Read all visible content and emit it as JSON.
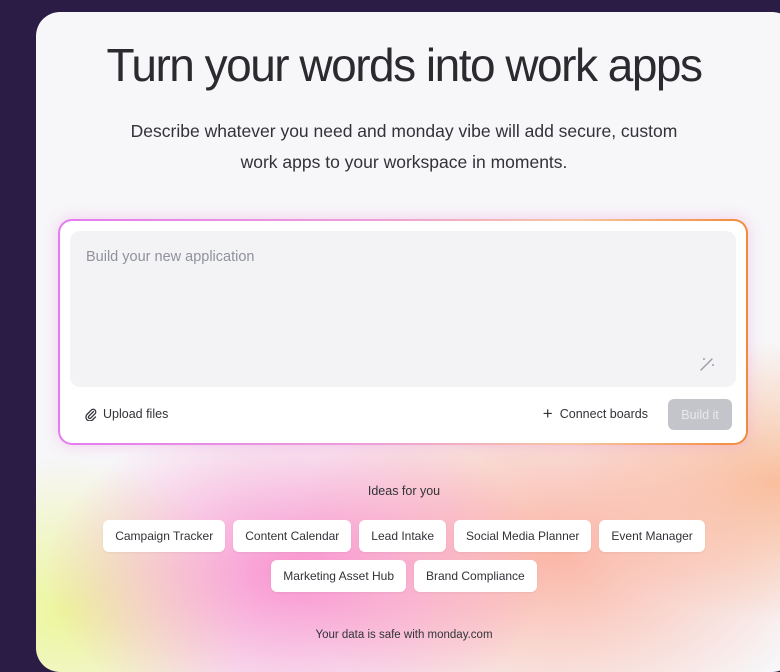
{
  "hero": {
    "title": "Turn your words into work apps",
    "subtitle_line1": "Describe whatever you need and monday vibe will add secure, custom",
    "subtitle_line2": "work apps to your workspace in moments."
  },
  "composer": {
    "placeholder": "Build your new application",
    "value": "",
    "upload_label": "Upload files",
    "connect_label": "Connect boards",
    "build_label": "Build it"
  },
  "ideas": {
    "title": "Ideas for you",
    "chips": [
      "Campaign Tracker",
      "Content Calendar",
      "Lead Intake",
      "Social Media Planner",
      "Event Manager",
      "Marketing Asset Hub",
      "Brand Compliance"
    ]
  },
  "footer": {
    "text": "Your data is safe with monday.com"
  },
  "icons": {
    "upload": "paperclip-icon",
    "connect": "plus-icon",
    "magic": "magic-pen-icon"
  },
  "colors": {
    "background": "#2a1c44",
    "build_button_disabled": "#c4c5cb",
    "border_gradient_start": "#e37cf0",
    "border_gradient_end": "#f18a3a"
  }
}
